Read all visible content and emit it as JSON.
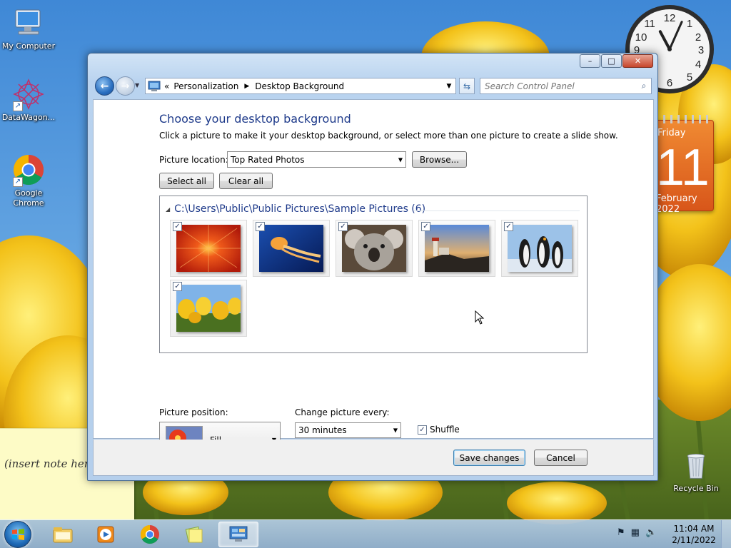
{
  "desktop": {
    "icons": [
      {
        "label": "My Computer",
        "icon": "computer-icon"
      },
      {
        "label": "DataWagon...",
        "icon": "datawagon-icon"
      },
      {
        "label": "Google Chrome",
        "icon": "chrome-icon"
      }
    ],
    "recycle_bin": "Recycle Bin",
    "sticky_note": "(insert note here)",
    "clock_gadget": {
      "hour": 11,
      "minute": 4
    },
    "calendar_gadget": {
      "weekday": "Friday",
      "day": "11",
      "month": "February 2022"
    }
  },
  "window": {
    "caption": {
      "minimize": "–",
      "maximize": "□",
      "close": "✕"
    },
    "address": {
      "overflow": "«",
      "crumbs": [
        "Personalization",
        "Desktop Background"
      ],
      "separator": "▶"
    },
    "search": {
      "placeholder": "Search Control Panel"
    },
    "heading": "Choose your desktop background",
    "subtext": "Click a picture to make it your desktop background, or select more than one picture to create a slide show.",
    "picture_location": {
      "label": "Picture location:",
      "value": "Top Rated Photos",
      "browse": "Browse..."
    },
    "select_all": "Select all",
    "clear_all": "Clear all",
    "group": {
      "path": "C:\\Users\\Public\\Public Pictures\\Sample Pictures (6)",
      "pictures": [
        {
          "name": "Chrysanthemum",
          "checked": true
        },
        {
          "name": "Jellyfish",
          "checked": true
        },
        {
          "name": "Koala",
          "checked": true
        },
        {
          "name": "Lighthouse",
          "checked": true
        },
        {
          "name": "Penguins",
          "checked": true
        },
        {
          "name": "Tulips",
          "checked": true
        }
      ]
    },
    "picture_position": {
      "label": "Picture position:",
      "value": "Fill"
    },
    "change_picture": {
      "label": "Change picture every:",
      "value": "30 minutes"
    },
    "shuffle": {
      "label": "Shuffle",
      "checked": true
    },
    "buttons": {
      "save": "Save changes",
      "cancel": "Cancel"
    }
  },
  "taskbar": {
    "time": "11:04 AM",
    "date": "2/11/2022",
    "pinned": [
      "explorer-icon",
      "media-player-icon",
      "chrome-icon",
      "sticky-notes-icon",
      "control-panel-icon"
    ],
    "active": "control-panel-icon"
  },
  "colors": {
    "heading": "#1e3a8a",
    "window_frame": "#b9d3ef",
    "calendar": "#e06a22"
  }
}
